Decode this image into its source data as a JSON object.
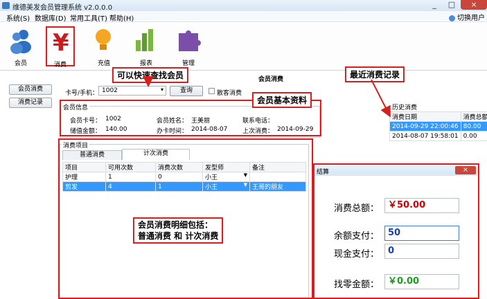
{
  "window": {
    "title": "维德美发会员管理系统 v2.0.0.0",
    "controls": [
      "_",
      "□",
      "×"
    ]
  },
  "menu": {
    "items": [
      "系统(S)",
      "数据库(D)",
      "常用工具(T)",
      "帮助(H)"
    ],
    "switch_user": "切换用户"
  },
  "toolbar": {
    "items": [
      "会员",
      "消费",
      "充值",
      "报表",
      "管理"
    ]
  },
  "left_buttons": {
    "member_consume": "会员消费",
    "consume_record": "消费记录"
  },
  "main": {
    "section_title": "会员消费",
    "card_label": "卡号/手机：",
    "card_value": "1002",
    "query_button": "查询",
    "guest_checkbox": "散客消费"
  },
  "member_info": {
    "title": "会员信息",
    "card_no_label": "会员卡号：",
    "card_no": "1002",
    "name_label": "会员姓名：",
    "name": "王美丽",
    "phone_label": "联系电话：",
    "phone": "",
    "balance_label": "储值金额：",
    "balance": "140.00",
    "open_date_label": "办卡时间：",
    "open_date": "2014-08-07",
    "last_consume_label": "上次消费：",
    "last_consume": "2014-09-29"
  },
  "consume_items": {
    "title": "消费项目",
    "tabs": [
      "普通消费",
      "计次消费"
    ],
    "columns": [
      "项目",
      "可用次数",
      "消费次数",
      "发型师",
      "备注"
    ],
    "rows": [
      {
        "item": "护理",
        "available": "1",
        "used": "0",
        "stylist": "小王",
        "note": ""
      },
      {
        "item": "剪发",
        "available": "4",
        "used": "1",
        "stylist": "小王",
        "note": "王哥的朋友"
      }
    ]
  },
  "history": {
    "title": "历史消费",
    "columns": [
      "消费日期",
      "消费总额"
    ],
    "rows": [
      {
        "date": "2014-09-29 22:00:46",
        "amount": "80.00"
      },
      {
        "date": "2014-08-07 19:58:01",
        "amount": "0.00"
      }
    ]
  },
  "dialog": {
    "title": "结算",
    "close": "×",
    "total_label": "消费总额：",
    "total_value": "￥50.00",
    "balance_pay_label": "余额支付：",
    "balance_pay_value": "50",
    "cash_pay_label": "现金支付：",
    "cash_pay_value": "0",
    "change_label": "找零金额：",
    "change_value": "￥0.00"
  },
  "annotations": {
    "quick_find": "可以快速查找会员",
    "basic_info": "会员基本资料",
    "recent_records": "最近消费记录",
    "detail_line1": "会员消费明细包括：",
    "detail_line2": "普通消费 和 计次消费"
  },
  "colors": {
    "accent_red": "#d62020",
    "selection_blue": "#3399ff",
    "total_red": "#cc0000",
    "change_green": "#1a9c1a",
    "balance_blue": "#1d3fa8"
  }
}
